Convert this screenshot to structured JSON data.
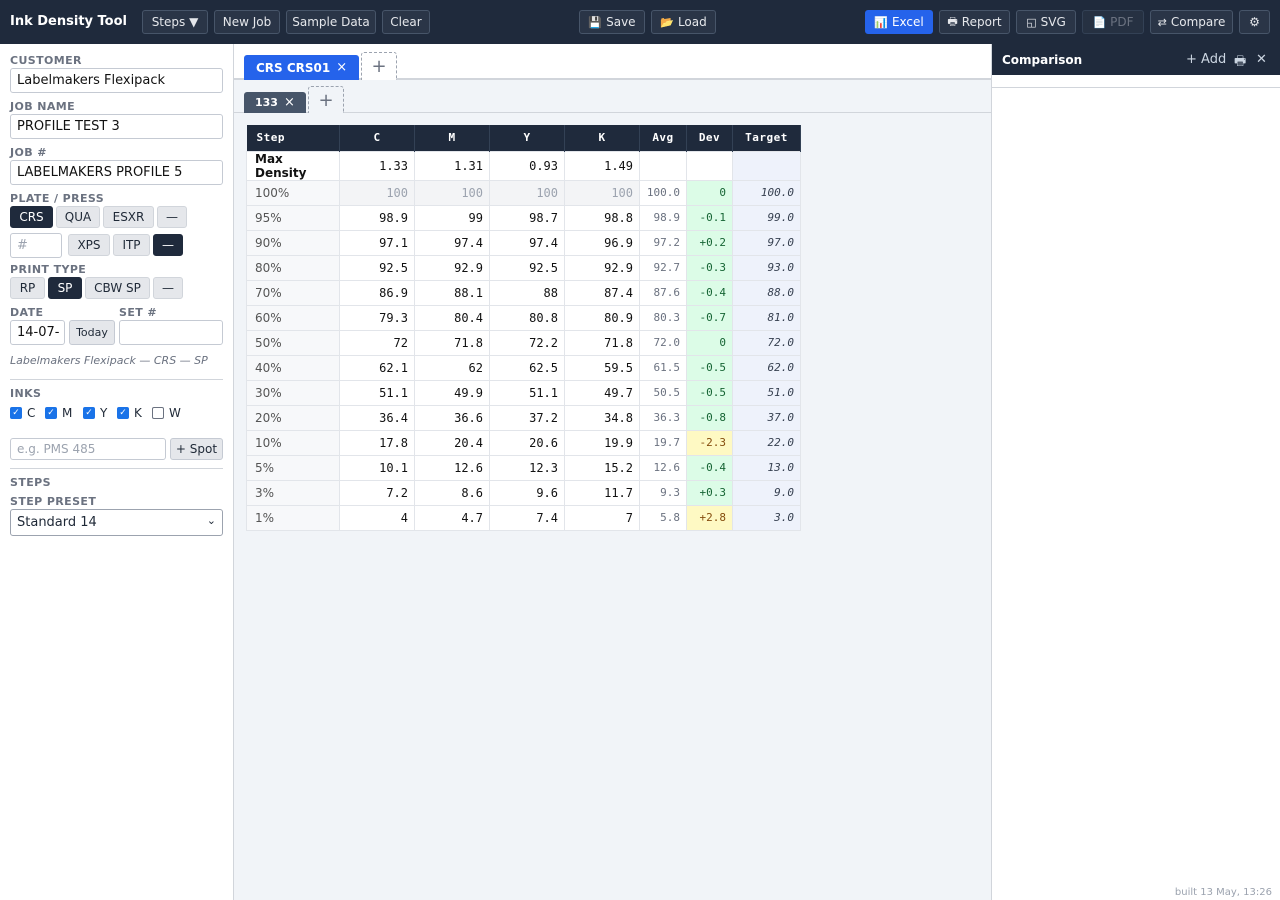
{
  "app": {
    "title": "Ink Density Tool"
  },
  "toolbar": {
    "steps": "Steps ▼",
    "new_job": "New Job",
    "sample_data": "Sample Data",
    "clear": "Clear",
    "save": "Save",
    "load": "Load",
    "excel": "Excel",
    "report": "Report",
    "svg": "SVG",
    "pdf": "PDF",
    "compare": "Compare"
  },
  "form": {
    "customer_label": "CUSTOMER",
    "customer": "Labelmakers Flexipack",
    "job_name_label": "JOB NAME",
    "job_name": "PROFILE TEST 3",
    "job_no_label": "JOB #",
    "job_no": "LABELMAKERS PROFILE 5",
    "plate_label": "PLATE / PRESS",
    "plates": [
      "CRS",
      "QUA",
      "ESXR",
      "—"
    ],
    "press_placeholder": "#",
    "presses": [
      "XPS",
      "ITP",
      "—"
    ],
    "print_type_label": "PRINT TYPE",
    "print_types": [
      "RP",
      "SP",
      "CBW SP",
      "—"
    ],
    "date_label": "DATE",
    "date": "14-07-",
    "today": "Today",
    "set_label": "SET #",
    "set": "",
    "summary": "Labelmakers Flexipack — CRS — SP",
    "inks_label": "INKS",
    "inks": [
      {
        "name": "C",
        "checked": true
      },
      {
        "name": "M",
        "checked": true
      },
      {
        "name": "Y",
        "checked": true
      },
      {
        "name": "K",
        "checked": true
      },
      {
        "name": "W",
        "checked": false
      }
    ],
    "spot_placeholder": "e.g. PMS 485",
    "spot_button": "+ Spot",
    "steps_label": "STEPS",
    "step_preset_label": "STEP PRESET",
    "step_preset": "Standard 14"
  },
  "tabs": {
    "plate_tab": "CRS CRS01",
    "add": "+",
    "sub_tab": "133"
  },
  "table": {
    "headers": [
      "Step",
      "C",
      "M",
      "Y",
      "K",
      "Avg",
      "Dev",
      "Target"
    ],
    "max_density": {
      "label": "Max Density",
      "C": "1.33",
      "M": "1.31",
      "Y": "0.93",
      "K": "1.49"
    },
    "rows": [
      {
        "step": "100%",
        "C": "100",
        "M": "100",
        "Y": "100",
        "K": "100",
        "avg": "100.0",
        "dev": "0",
        "target": "100.0"
      },
      {
        "step": "95%",
        "C": "98.9",
        "M": "99",
        "Y": "98.7",
        "K": "98.8",
        "avg": "98.9",
        "dev": "-0.1",
        "target": "99.0"
      },
      {
        "step": "90%",
        "C": "97.1",
        "M": "97.4",
        "Y": "97.4",
        "K": "96.9",
        "avg": "97.2",
        "dev": "+0.2",
        "target": "97.0"
      },
      {
        "step": "80%",
        "C": "92.5",
        "M": "92.9",
        "Y": "92.5",
        "K": "92.9",
        "avg": "92.7",
        "dev": "-0.3",
        "target": "93.0"
      },
      {
        "step": "70%",
        "C": "86.9",
        "M": "88.1",
        "Y": "88",
        "K": "87.4",
        "avg": "87.6",
        "dev": "-0.4",
        "target": "88.0"
      },
      {
        "step": "60%",
        "C": "79.3",
        "M": "80.4",
        "Y": "80.8",
        "K": "80.9",
        "avg": "80.3",
        "dev": "-0.7",
        "target": "81.0"
      },
      {
        "step": "50%",
        "C": "72",
        "M": "71.8",
        "Y": "72.2",
        "K": "71.8",
        "avg": "72.0",
        "dev": "0",
        "target": "72.0"
      },
      {
        "step": "40%",
        "C": "62.1",
        "M": "62",
        "Y": "62.5",
        "K": "59.5",
        "avg": "61.5",
        "dev": "-0.5",
        "target": "62.0"
      },
      {
        "step": "30%",
        "C": "51.1",
        "M": "49.9",
        "Y": "51.1",
        "K": "49.7",
        "avg": "50.5",
        "dev": "-0.5",
        "target": "51.0"
      },
      {
        "step": "20%",
        "C": "36.4",
        "M": "36.6",
        "Y": "37.2",
        "K": "34.8",
        "avg": "36.3",
        "dev": "-0.8",
        "target": "37.0"
      },
      {
        "step": "10%",
        "C": "17.8",
        "M": "20.4",
        "Y": "20.6",
        "K": "19.9",
        "avg": "19.7",
        "dev": "-2.3",
        "target": "22.0",
        "warn": true
      },
      {
        "step": "5%",
        "C": "10.1",
        "M": "12.6",
        "Y": "12.3",
        "K": "15.2",
        "avg": "12.6",
        "dev": "-0.4",
        "target": "13.0"
      },
      {
        "step": "3%",
        "C": "7.2",
        "M": "8.6",
        "Y": "9.6",
        "K": "11.7",
        "avg": "9.3",
        "dev": "+0.3",
        "target": "9.0"
      },
      {
        "step": "1%",
        "C": "4",
        "M": "4.7",
        "Y": "7.4",
        "K": "7",
        "avg": "5.8",
        "dev": "+2.8",
        "target": "3.0",
        "warn": true
      }
    ]
  },
  "comparison": {
    "title": "Comparison",
    "add": "+ Add"
  },
  "footer": {
    "built": "built 13 May, 13:26"
  },
  "colors": {
    "accent": "#2563eb",
    "header": "#1f2a3c",
    "dev_ok": "#dcfce7",
    "dev_warn": "#fef9c3"
  }
}
